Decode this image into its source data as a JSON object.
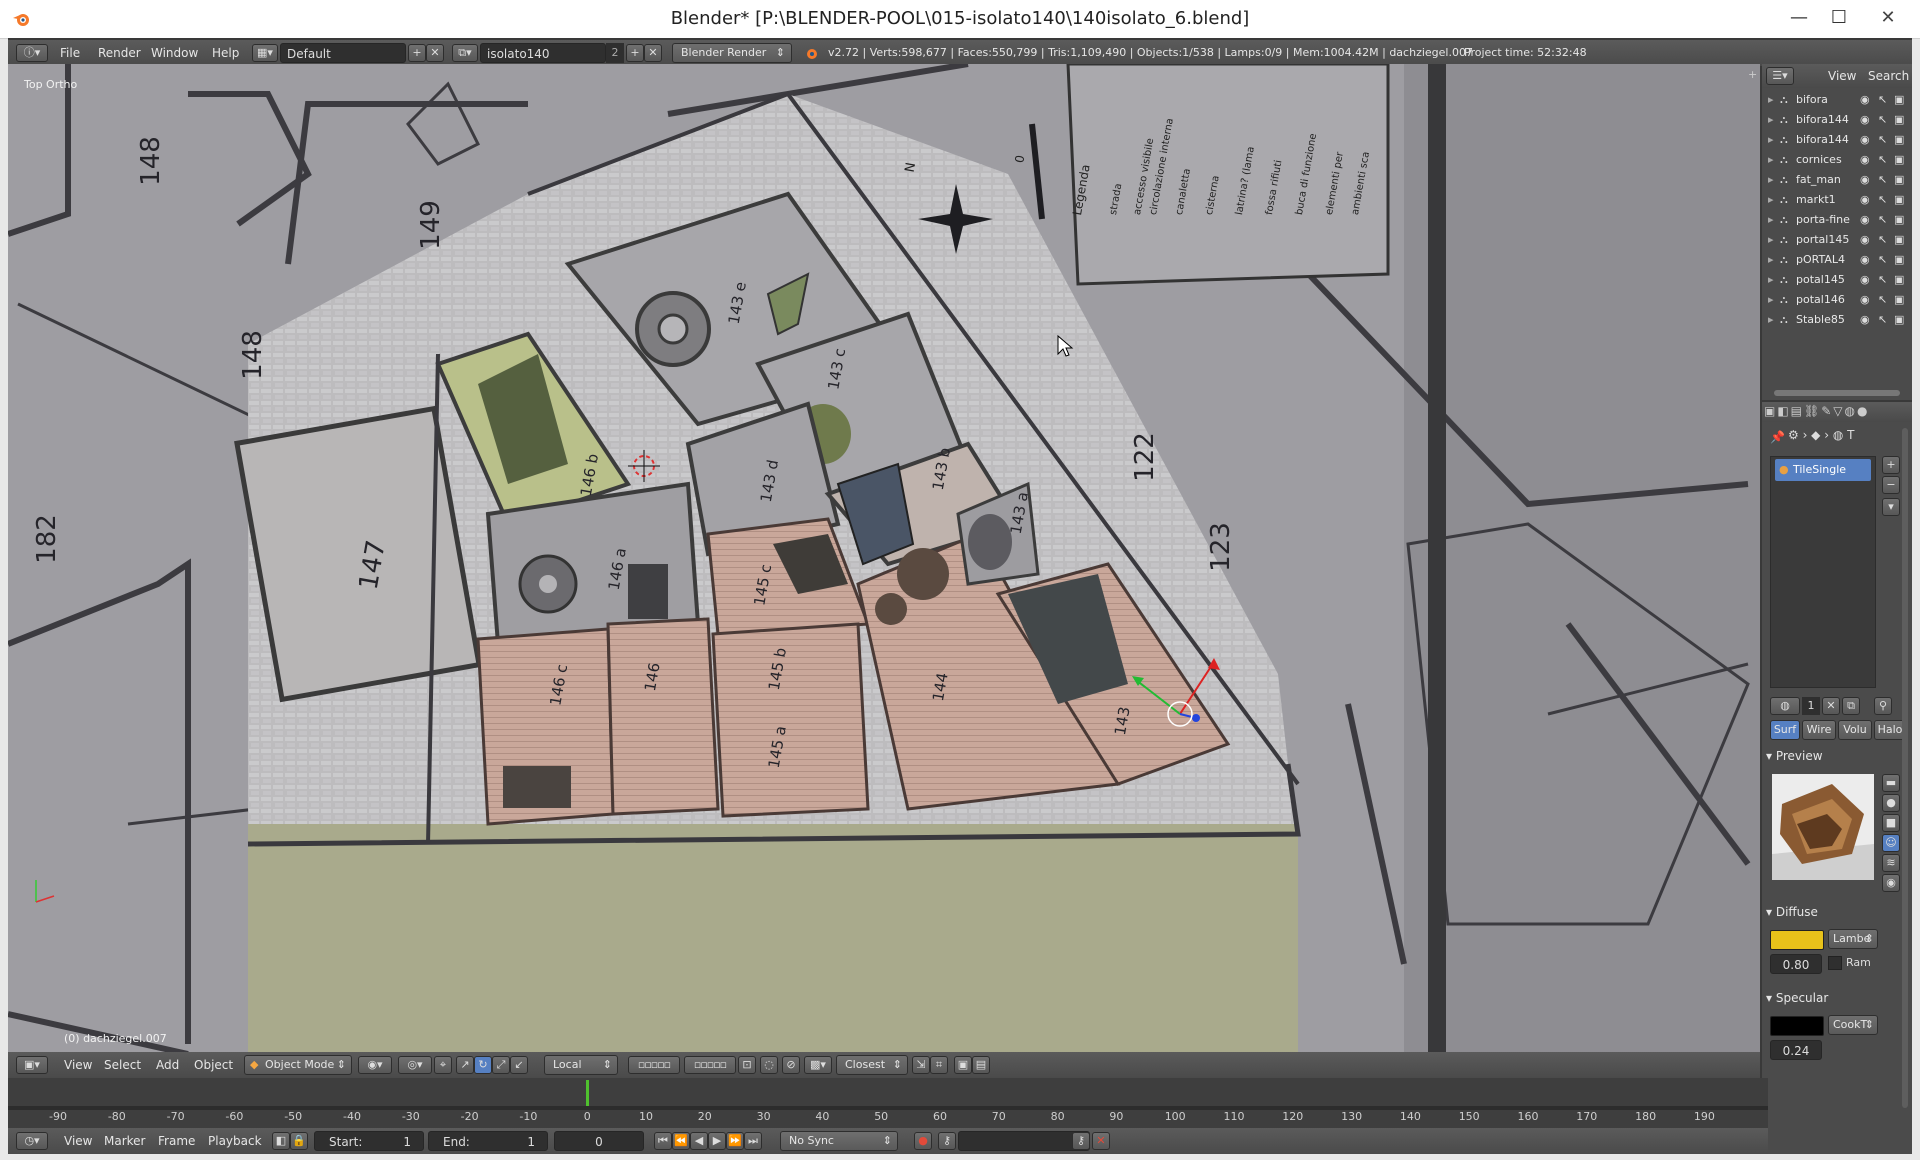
{
  "window": {
    "title": "Blender* [P:\\BLENDER-POOL\\015-isolato140\\140isolato_6.blend]",
    "minimize": "—",
    "maximize": "☐",
    "close": "✕",
    "close_color": "#e81123"
  },
  "info_header": {
    "menus": [
      "File",
      "Render",
      "Window",
      "Help"
    ],
    "screen_layout": "Default",
    "scene": "isolato140",
    "scene_users": "2",
    "render_engine": "Blender Render",
    "stats": "v2.72 | Verts:598,677 | Faces:550,799 | Tris:1,109,490 | Objects:1/538 | Lamps:0/9 | Mem:1004.42M | dachziegel.007",
    "project_time": "Project time: 52:32:48"
  },
  "viewport": {
    "view_name": "Top Ortho",
    "active_object": "(0) dachziegel.007",
    "map_labels": [
      "148",
      "149",
      "148",
      "182",
      "147",
      "122",
      "123",
      "143 e",
      "143 c",
      "143 d",
      "143 b",
      "146 b",
      "146 a",
      "145 c",
      "146 c",
      "146",
      "145 b",
      "145 a",
      "144",
      "143",
      "143 a"
    ],
    "legend_title": "Legenda",
    "legend_items": [
      "strada",
      "accesso visibile",
      "circolazione interna",
      "canaletta",
      "cisterna",
      "latrina? (lama",
      "fossa rifiuti",
      "buca di funzione",
      "elementi per",
      "ambienti sca"
    ],
    "north_label": "N",
    "scale_label": "0"
  },
  "viewport_header": {
    "menus": [
      "View",
      "Select",
      "Add",
      "Object"
    ],
    "mode": "Object Mode",
    "orientation": "Local",
    "snap": "Closest"
  },
  "outliner": {
    "menus": [
      "View",
      "Search"
    ],
    "items": [
      "bifora",
      "bifora144",
      "bifora144",
      "cornices",
      "fat_man",
      "markt1",
      "porta-fine",
      "portal145",
      "pORTAL4",
      "potal145",
      "potal146",
      "Stable85"
    ]
  },
  "properties": {
    "texture_name": "TileSingle",
    "breadcrumb_suffix": "T",
    "tabs": [
      "Surf",
      "Wire",
      "Volu",
      "Halo"
    ],
    "slot_count": "1",
    "preview_label": "Preview",
    "diffuse_label": "Diffuse",
    "diffuse_color": "#e8c21a",
    "diffuse_shader": "Lambe",
    "diffuse_intensity": "0.80",
    "ramp_label": "Ram",
    "specular_label": "Specular",
    "specular_color": "#000000",
    "specular_shader": "CookT",
    "specular_intensity": "0.24"
  },
  "timeline": {
    "ruler": [
      "-90",
      "-80",
      "-70",
      "-60",
      "-50",
      "-40",
      "-30",
      "-20",
      "-10",
      "0",
      "10",
      "20",
      "30",
      "40",
      "50",
      "60",
      "70",
      "80",
      "90",
      "100",
      "110",
      "120",
      "130",
      "140",
      "150",
      "160",
      "170",
      "180",
      "190"
    ],
    "current_frame_marker": 0,
    "menus": [
      "View",
      "Marker",
      "Frame",
      "Playback"
    ],
    "start_label": "Start:",
    "start_value": "1",
    "end_label": "End:",
    "end_value": "1",
    "frame_value": "0",
    "sync": "No Sync"
  }
}
